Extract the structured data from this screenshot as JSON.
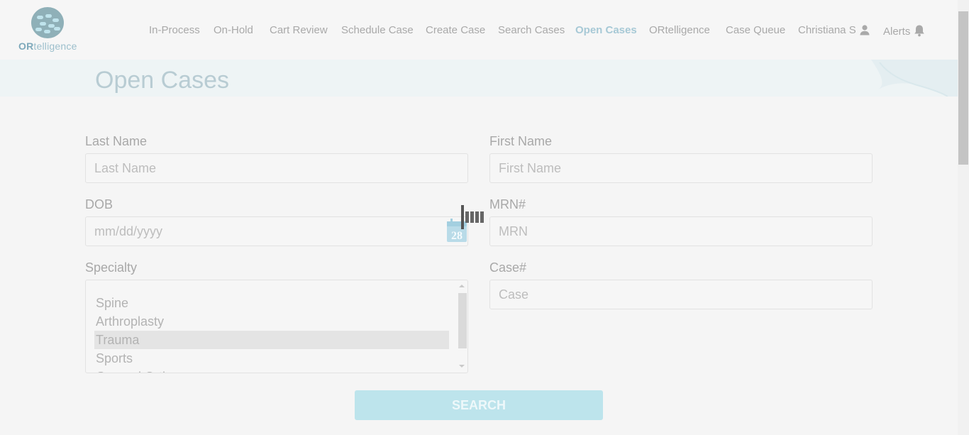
{
  "brand": {
    "logo_text_bold": "OR",
    "logo_text_rest": "telligence"
  },
  "nav": {
    "items": [
      "In-Process",
      "On-Hold",
      "Cart Review",
      "Schedule Case",
      "Create Case",
      "Search Cases",
      "Open Cases",
      "ORtelligence",
      "Case Queue"
    ],
    "active": "Open Cases",
    "user": "Christiana S",
    "alerts": "Alerts"
  },
  "page": {
    "title": "Open Cases"
  },
  "form": {
    "last_name": {
      "label": "Last Name",
      "placeholder": "Last Name",
      "value": ""
    },
    "first_name": {
      "label": "First Name",
      "placeholder": "First Name",
      "value": ""
    },
    "dob": {
      "label": "DOB",
      "placeholder": "mm/dd/yyyy",
      "value": "",
      "calendar_day": "28"
    },
    "mrn": {
      "label": "MRN#",
      "placeholder": "MRN",
      "value": ""
    },
    "specialty": {
      "label": "Specialty",
      "options": [
        "Spine",
        "Arthroplasty",
        "Trauma",
        "Sports",
        "General Orth"
      ],
      "selected": "Trauma"
    },
    "case": {
      "label": "Case#",
      "placeholder": "Case",
      "value": ""
    },
    "search_label": "SEARCH"
  },
  "colors": {
    "accent": "#a7c9d6",
    "button": "#bde4ec",
    "banner": "#eef4f5"
  },
  "icons": {
    "user": "user-icon",
    "alerts": "bell-icon",
    "calendar": "calendar-icon"
  }
}
